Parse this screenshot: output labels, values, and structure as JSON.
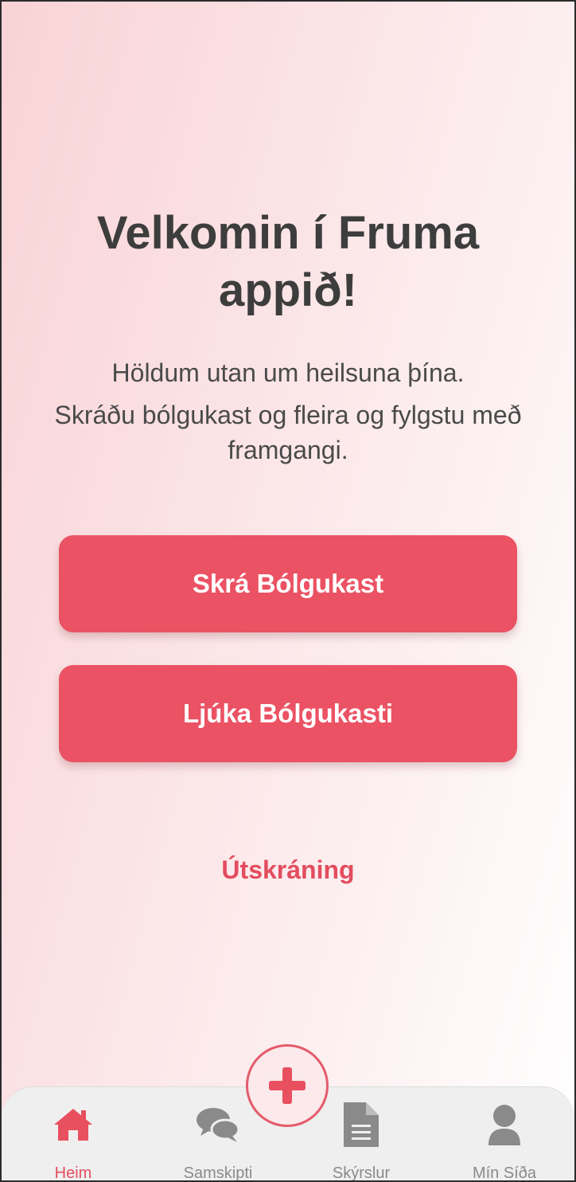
{
  "welcome": {
    "title_line1": "Velkomin í Fruma",
    "title_line2": "appið!",
    "subtitle_line1": "Höldum utan um heilsuna þína.",
    "subtitle_line2": "Skráðu bólgukast og fleira og fylgstu með framgangi."
  },
  "actions": {
    "register_flare": "Skrá Bólgukast",
    "finish_flare": "Ljúka Bólgukasti",
    "logout": "Útskráning"
  },
  "tabbar": {
    "fab_icon": "plus-icon",
    "tabs": [
      {
        "label": "Heim",
        "icon": "home-icon",
        "active": true
      },
      {
        "label": "Samskipti",
        "icon": "chat-bubbles-icon",
        "active": false
      },
      {
        "label": "Skýrslur",
        "icon": "document-icon",
        "active": false
      },
      {
        "label": "Mín Síða",
        "icon": "user-icon",
        "active": false
      }
    ]
  },
  "colors": {
    "accent": "#eb5264",
    "inactive": "#8a8a8a",
    "text": "#3d3d3d"
  }
}
